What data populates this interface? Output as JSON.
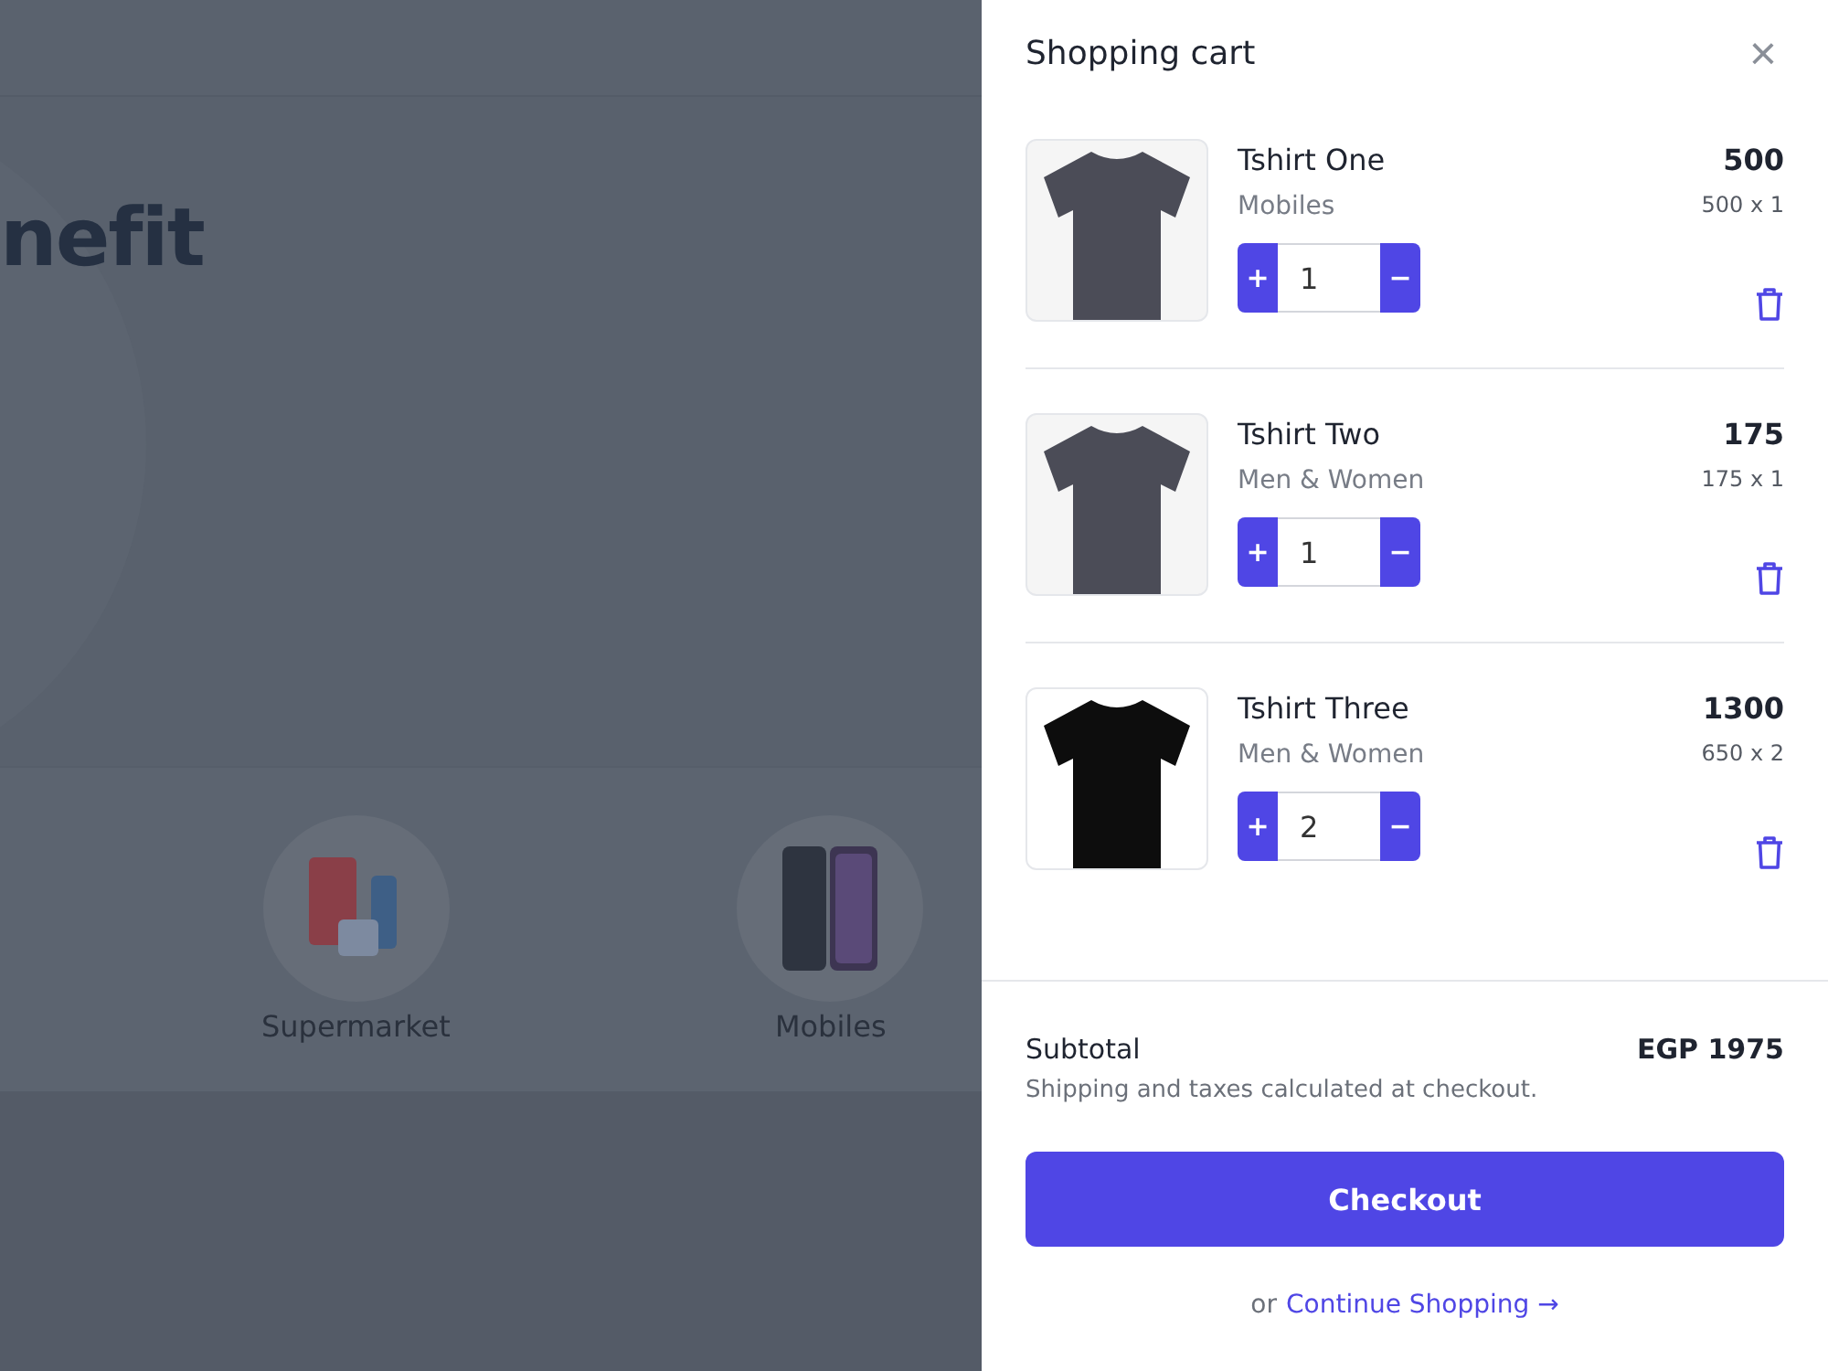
{
  "background_page": {
    "hero_heading": "nefit",
    "categories": [
      {
        "label": "Supermarket"
      },
      {
        "label": "Mobiles"
      }
    ]
  },
  "cart": {
    "title": "Shopping cart",
    "close_icon": "×",
    "items": [
      {
        "name": "Tshirt One",
        "category": "Mobiles",
        "price": "500",
        "unit_price": "500 x 1",
        "quantity": "1",
        "increase": "+",
        "decrease": "−",
        "color": "#4b4c57"
      },
      {
        "name": "Tshirt Two",
        "category": "Men & Women",
        "price": "175",
        "unit_price": "175 x 1",
        "quantity": "1",
        "increase": "+",
        "decrease": "−",
        "color": "#4b4c57"
      },
      {
        "name": "Tshirt Three",
        "category": "Men & Women",
        "price": "1300",
        "unit_price": "650 x 2",
        "quantity": "2",
        "increase": "+",
        "decrease": "−",
        "color": "#0d0d0d"
      }
    ],
    "subtotal_label": "Subtotal",
    "subtotal": "EGP 1975",
    "note": "Shipping and taxes calculated at checkout.",
    "checkout": "Checkout",
    "or": "or",
    "continue_link": "Continue Shopping →"
  }
}
